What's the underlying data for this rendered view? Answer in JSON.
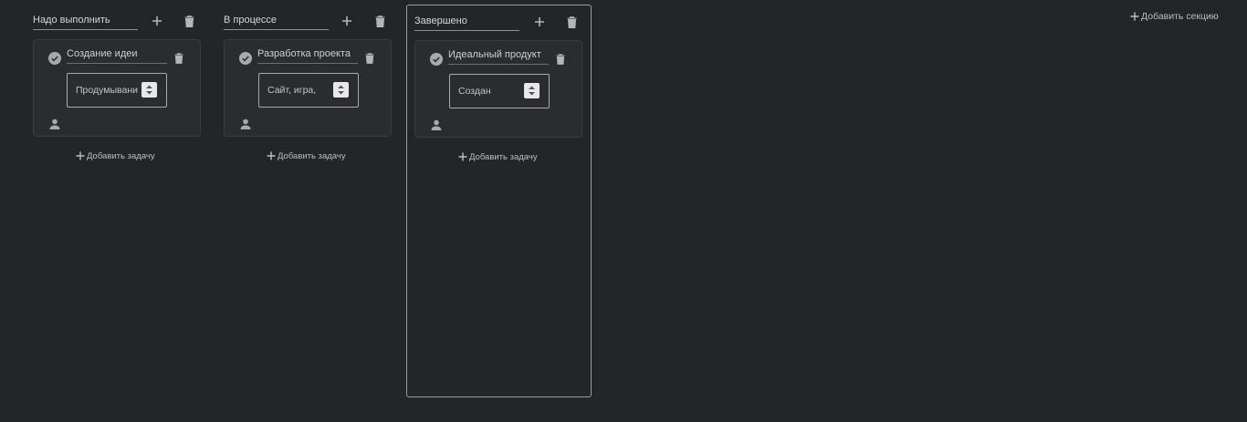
{
  "sections": [
    {
      "title": "Надо выполнить",
      "tasks": [
        {
          "title": "Создание идеи",
          "description": "Продумывани"
        }
      ],
      "add_task_label": "Добавить задачу"
    },
    {
      "title": "В процессе",
      "tasks": [
        {
          "title": "Разработка проекта",
          "description": "Сайт, игра,"
        }
      ],
      "add_task_label": "Добавить задачу"
    },
    {
      "title": "Завершено",
      "tasks": [
        {
          "title": "Идеальный продукт",
          "description": "Создан"
        }
      ],
      "add_task_label": "Добавить задачу"
    }
  ],
  "add_section_label": "Добавить секцию",
  "icons": {
    "section_add": "plus-icon",
    "section_delete": "trash-icon",
    "task_done": "check-circle-icon",
    "task_delete": "trash-icon",
    "assignee": "person-icon",
    "spinner": "up-down-arrows-icon"
  },
  "colors": {
    "background": "#242527",
    "card": "#2b2c2f",
    "text": "#c9c9cb",
    "icon": "#b5b5b7",
    "active_section_border": "#9a9b9e"
  }
}
